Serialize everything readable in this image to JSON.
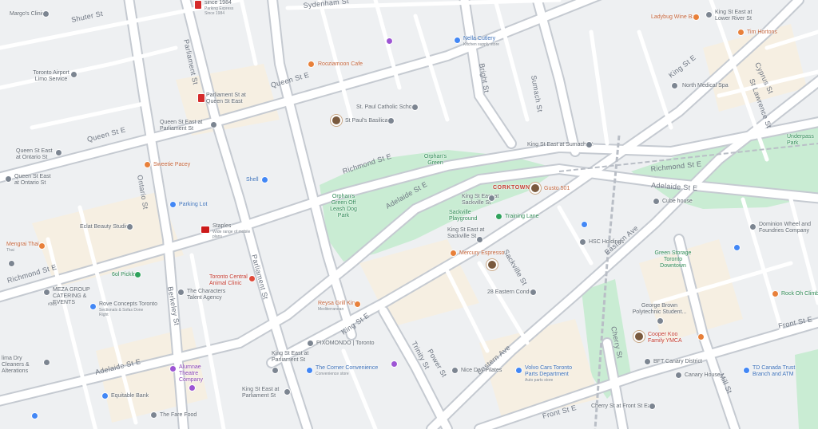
{
  "map": {
    "roads": [
      {
        "label": "Queen St E"
      },
      {
        "label": "Queen St E"
      },
      {
        "label": "Richmond St E"
      },
      {
        "label": "Richmond St E"
      },
      {
        "label": "Richmond St E"
      },
      {
        "label": "Adelaide St E"
      },
      {
        "label": "Adelaide St E"
      },
      {
        "label": "Adelaide St E"
      },
      {
        "label": "King St E"
      },
      {
        "label": "King St E"
      },
      {
        "label": "Front St E"
      },
      {
        "label": "Front St E"
      },
      {
        "label": "Eastern Ave"
      },
      {
        "label": "Eastern Ave"
      },
      {
        "label": "Parliament St"
      },
      {
        "label": "Parliament St"
      },
      {
        "label": "Sackville St"
      },
      {
        "label": "Sumach St"
      },
      {
        "label": "Ontario St"
      },
      {
        "label": "Berkeley St"
      },
      {
        "label": "Power St"
      },
      {
        "label": "Trinity St"
      },
      {
        "label": "Cherry St"
      },
      {
        "label": "Shuter St"
      },
      {
        "label": "Sydenham St"
      },
      {
        "label": "Bright St"
      },
      {
        "label": "Cyprus St"
      },
      {
        "label": "St Lawrence St"
      },
      {
        "label": "Mill St"
      }
    ],
    "places": [
      {
        "name": "Margo's Clinic",
        "sub": ""
      },
      {
        "name": "Toronto Airport Limo Service",
        "sub": ""
      },
      {
        "name": "Queen St East at Ontario St",
        "sub": ""
      },
      {
        "name": "Queen St East at Ontario St",
        "sub": ""
      },
      {
        "name": "Queen St East at Parliament St",
        "sub": ""
      },
      {
        "name": "Parliament St at Queen St East",
        "sub": ""
      },
      {
        "name": "Rooziamoon Cafe",
        "sub": ""
      },
      {
        "name": "Sweetie Pacey",
        "sub": ""
      },
      {
        "name": "Shell",
        "sub": ""
      },
      {
        "name": "Parking Lot",
        "sub": ""
      },
      {
        "name": "Staples",
        "sub": "Wide range of mobile plans"
      },
      {
        "name": "Eclat Beauty Studio",
        "sub": ""
      },
      {
        "name": "Mengrai Thai",
        "sub": "Thai"
      },
      {
        "name": "6ol Pickle",
        "sub": ""
      },
      {
        "name": "MEZA GROUP CATERING & EVENTS",
        "sub": "#305"
      },
      {
        "name": "Rove Concepts Toronto",
        "sub": "Sectionals & Sofas Done Right"
      },
      {
        "name": "Toronto Central Animal Clinic",
        "sub": ""
      },
      {
        "name": "The Characters Talent Agency",
        "sub": ""
      },
      {
        "name": "Reysa Grill King",
        "sub": "Mediterranean"
      },
      {
        "name": "PIXOMONDO | Toronto",
        "sub": ""
      },
      {
        "name": "King St East at Parliament St",
        "sub": ""
      },
      {
        "name": "King St East at Parliament St",
        "sub": ""
      },
      {
        "name": "Alumnae Theatre Company",
        "sub": ""
      },
      {
        "name": "Equitable Bank",
        "sub": ""
      },
      {
        "name": "The Fare Food",
        "sub": ""
      },
      {
        "name": "lima Dry Cleaners & Alterations",
        "sub": ""
      },
      {
        "name": "The Corner Convenience",
        "sub": "Convenience store"
      },
      {
        "name": "Nice Day Pilates",
        "sub": ""
      },
      {
        "name": "Volvo Cars Toronto Parts Department",
        "sub": "Auto parts store"
      },
      {
        "name": "28 Eastern Condos",
        "sub": ""
      },
      {
        "name": "Mercury Espresso",
        "sub": ""
      },
      {
        "name": "King St East at Sackville St",
        "sub": ""
      },
      {
        "name": "King St East at Sackville St",
        "sub": ""
      },
      {
        "name": "Sackville Playground",
        "sub": ""
      },
      {
        "name": "Training Lane",
        "sub": ""
      },
      {
        "name": "Orphan's Green Off Leash Dog Park",
        "sub": ""
      },
      {
        "name": "Orphan's Green",
        "sub": ""
      },
      {
        "name": "CORKTOWN",
        "sub": ""
      },
      {
        "name": "Gusto 501",
        "sub": ""
      },
      {
        "name": "King St East at Sumach St",
        "sub": ""
      },
      {
        "name": "St. Paul Catholic School",
        "sub": ""
      },
      {
        "name": "St Paul's Basilica",
        "sub": ""
      },
      {
        "name": "Nella Cutlery",
        "sub": "Kitchen supply store"
      },
      {
        "name": "Ladybug Wine Bar",
        "sub": ""
      },
      {
        "name": "King St East at Lower River St",
        "sub": ""
      },
      {
        "name": "Tim Hortons",
        "sub": ""
      },
      {
        "name": "North Medical Spa",
        "sub": ""
      },
      {
        "name": "Underpass Park",
        "sub": ""
      },
      {
        "name": "Cube house",
        "sub": ""
      },
      {
        "name": "Dominion Wheel and Foundries Company",
        "sub": ""
      },
      {
        "name": "HSC Holdings",
        "sub": ""
      },
      {
        "name": "Green Storage Toronto Downtown",
        "sub": ""
      },
      {
        "name": "George Brown Polytechnic Student...",
        "sub": ""
      },
      {
        "name": "Cooper Koo Family YMCA",
        "sub": ""
      },
      {
        "name": "BFT Canary District",
        "sub": ""
      },
      {
        "name": "Canary House",
        "sub": ""
      },
      {
        "name": "TD Canada Trust Branch and ATM",
        "sub": ""
      },
      {
        "name": "Rock Oh Climbing",
        "sub": ""
      },
      {
        "name": "Cherry St at Front St East",
        "sub": ""
      },
      {
        "name": "since 1984",
        "sub": "Parking Express Since 1984"
      }
    ]
  }
}
